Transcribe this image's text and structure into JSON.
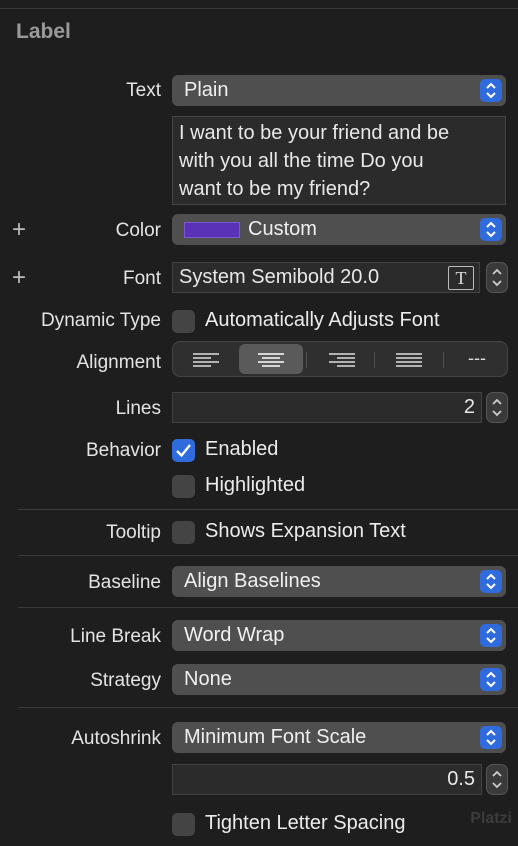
{
  "section_title": "Label",
  "text": {
    "label": "Text",
    "style": "Plain",
    "value": "I want to be your friend and be\nwith you all the time Do you\nwant to be my friend?"
  },
  "color": {
    "label": "Color",
    "value": "Custom",
    "swatch": "#5a32b8",
    "add_icon": "plus-icon"
  },
  "font": {
    "label": "Font",
    "value": "System Semibold 20.0",
    "add_icon": "plus-icon",
    "picker_icon": "T"
  },
  "dynamic_type": {
    "label": "Dynamic Type",
    "checkbox_label": "Automatically Adjusts Font",
    "checked": false
  },
  "alignment": {
    "label": "Alignment",
    "options": [
      "left",
      "center",
      "right",
      "justified",
      "natural"
    ],
    "selected": "center",
    "natural_glyph": "---"
  },
  "lines": {
    "label": "Lines",
    "value": "2"
  },
  "behavior": {
    "label": "Behavior",
    "enabled_label": "Enabled",
    "enabled": true,
    "highlighted_label": "Highlighted",
    "highlighted": false
  },
  "tooltip": {
    "label": "Tooltip",
    "checkbox_label": "Shows Expansion Text",
    "checked": false
  },
  "baseline": {
    "label": "Baseline",
    "value": "Align Baselines"
  },
  "line_break": {
    "label": "Line Break",
    "value": "Word Wrap"
  },
  "strategy": {
    "label": "Strategy",
    "value": "None"
  },
  "autoshrink": {
    "label": "Autoshrink",
    "value": "Minimum Font Scale",
    "scale": "0.5"
  },
  "tighten": {
    "checkbox_label": "Tighten Letter Spacing",
    "checked": false
  },
  "watermark": "Platzi",
  "colors": {
    "accent": "#2f6bdc",
    "background": "#1e1e1e"
  }
}
